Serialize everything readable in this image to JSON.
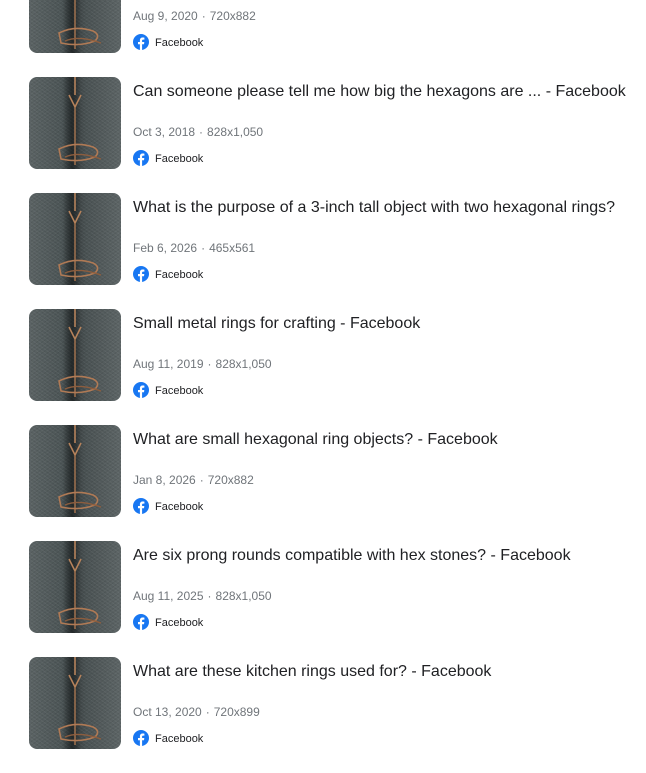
{
  "colors": {
    "facebook_blue": "#1877f2",
    "meta_gray": "#70757a",
    "text": "#202124"
  },
  "results": [
    {
      "title": "",
      "date": "Aug 9, 2020",
      "dimensions": "720x882",
      "source": "Facebook",
      "source_icon": "facebook-icon"
    },
    {
      "title": "Can someone please tell me how big the hexagons are ... - Facebook",
      "date": "Oct 3, 2018",
      "dimensions": "828x1,050",
      "source": "Facebook",
      "source_icon": "facebook-icon"
    },
    {
      "title": "What is the purpose of a 3-inch tall object with two hexagonal rings?",
      "date": "Feb 6, 2026",
      "dimensions": "465x561",
      "source": "Facebook",
      "source_icon": "facebook-icon"
    },
    {
      "title": "Small metal rings for crafting - Facebook",
      "date": "Aug 11, 2019",
      "dimensions": "828x1,050",
      "source": "Facebook",
      "source_icon": "facebook-icon"
    },
    {
      "title": "What are small hexagonal ring objects? - Facebook",
      "date": "Jan 8, 2026",
      "dimensions": "720x882",
      "source": "Facebook",
      "source_icon": "facebook-icon"
    },
    {
      "title": "Are six prong rounds compatible with hex stones? - Facebook",
      "date": "Aug 11, 2025",
      "dimensions": "828x1,050",
      "source": "Facebook",
      "source_icon": "facebook-icon"
    },
    {
      "title": "What are these kitchen rings used for? - Facebook",
      "date": "Oct 13, 2020",
      "dimensions": "720x899",
      "source": "Facebook",
      "source_icon": "facebook-icon"
    }
  ]
}
